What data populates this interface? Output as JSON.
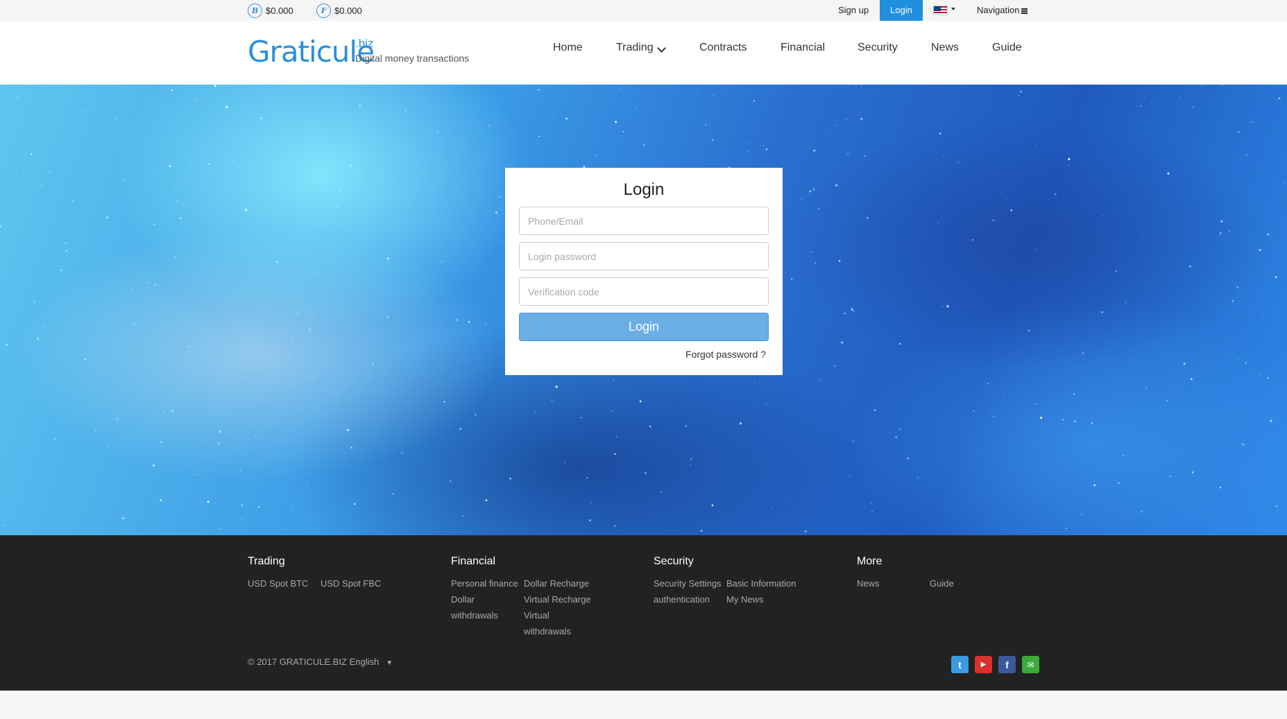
{
  "topbar": {
    "tickers": [
      {
        "symbol": "B",
        "price": "$0.000"
      },
      {
        "symbol": "F",
        "price": "$0.000"
      }
    ],
    "signup": "Sign up",
    "login": "Login",
    "navigation": "Navigation"
  },
  "header": {
    "logo": "Graticule",
    "logo_suffix": ".biz",
    "tagline": "Digital money transactions",
    "nav": [
      "Home",
      "Trading",
      "Contracts",
      "Financial",
      "Security",
      "News",
      "Guide"
    ]
  },
  "login_form": {
    "title": "Login",
    "phone_placeholder": "Phone/Email",
    "password_placeholder": "Login password",
    "code_placeholder": "Verification code",
    "submit": "Login",
    "forgot": "Forgot password ?"
  },
  "footer": {
    "columns": [
      {
        "title": "Trading",
        "links": [
          "USD Spot BTC",
          "USD Spot FBC"
        ]
      },
      {
        "title": "Financial",
        "links": [
          "Personal finance",
          "Dollar Recharge",
          "Dollar",
          "Virtual Recharge",
          "withdrawals",
          "Virtual",
          "withdrawals"
        ]
      },
      {
        "title": "Security",
        "links": [
          "Security Settings",
          "Basic Information",
          "authentication",
          "My News"
        ]
      },
      {
        "title": "More",
        "links": [
          "News",
          "Guide"
        ]
      }
    ],
    "copyright": "© 2017 GRATICULE.BIZ English",
    "language_caret": "▼",
    "social": [
      {
        "name": "twitter",
        "glyph": "t",
        "color": "#3a9be0"
      },
      {
        "name": "youtube",
        "glyph": "▶",
        "color": "#d9322e"
      },
      {
        "name": "facebook",
        "glyph": "f",
        "color": "#3b5a9a"
      },
      {
        "name": "wechat",
        "glyph": "✉",
        "color": "#3aab3a"
      }
    ]
  },
  "colors": {
    "accent": "#1f8fde",
    "login_button": "#6aaee6",
    "footer_bg": "#222222"
  }
}
